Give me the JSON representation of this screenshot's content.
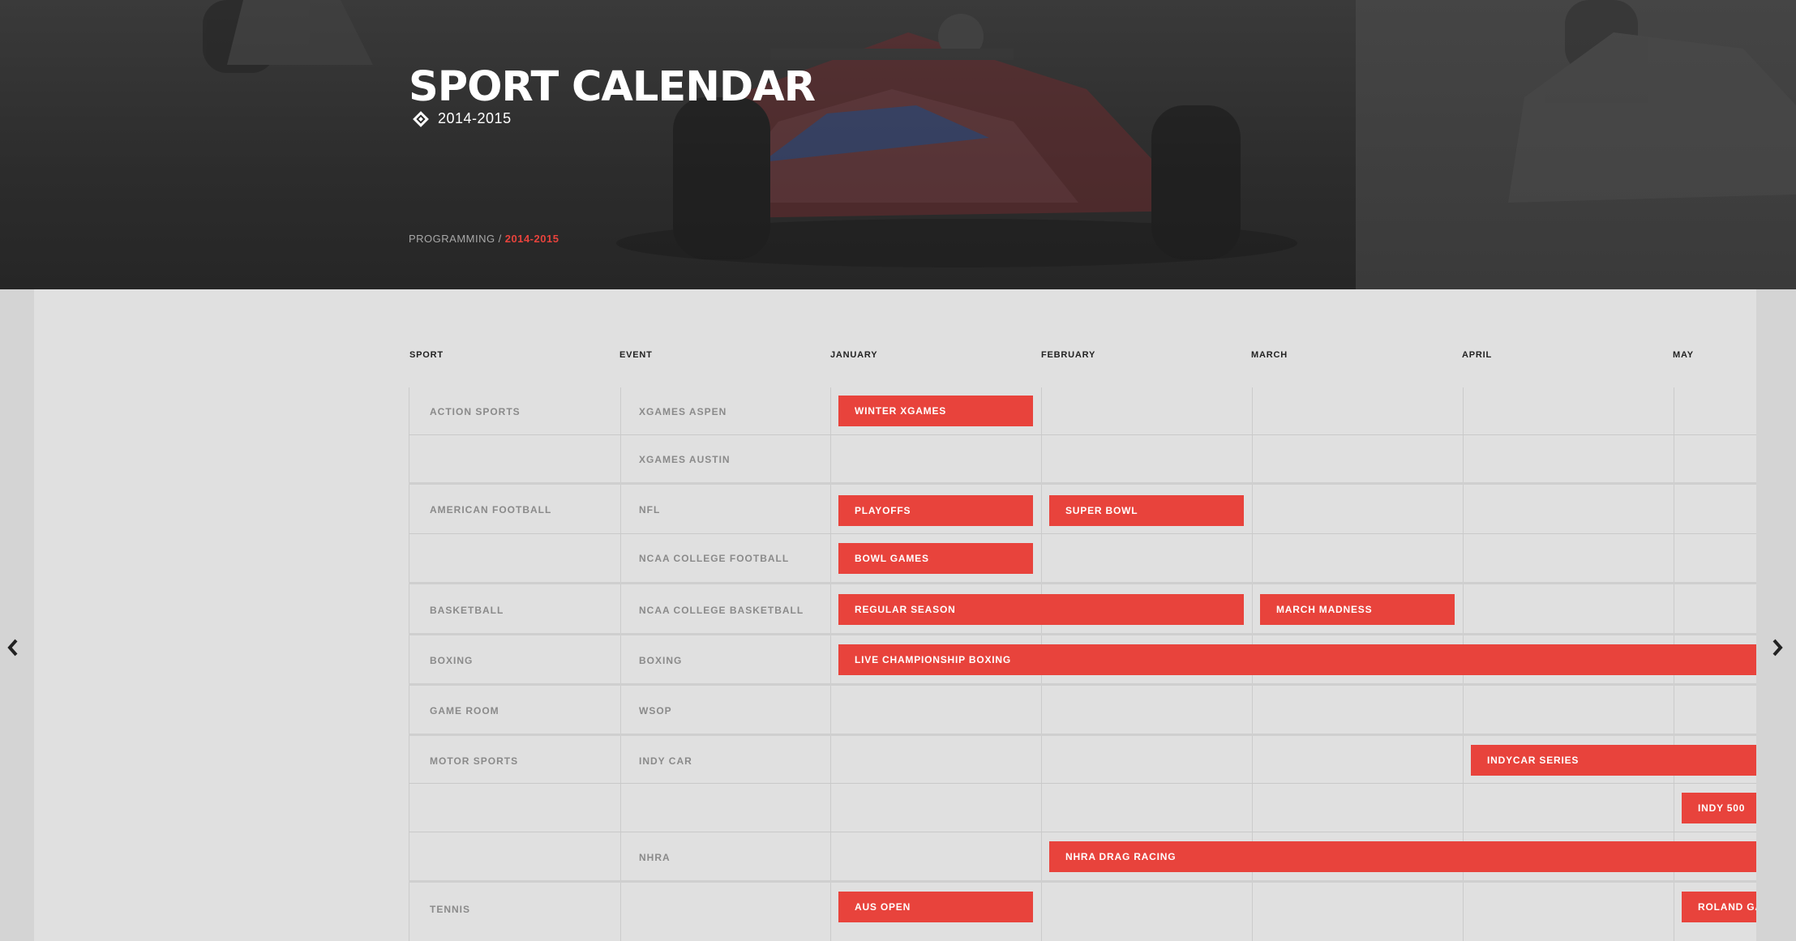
{
  "header": {
    "title": "SPORT CALENDAR",
    "season": "2014-2015",
    "breadcrumb": {
      "parent": "PROGRAMMING",
      "separator": "/",
      "current": "2014-2015"
    }
  },
  "columns": {
    "sport": "SPORT",
    "event": "EVENT",
    "months": [
      "JANUARY",
      "FEBRUARY",
      "MARCH",
      "APRIL",
      "MAY"
    ]
  },
  "rows": [
    {
      "sport": "ACTION SPORTS",
      "event": "XGAMES ASPEN"
    },
    {
      "sport": "",
      "event": "XGAMES AUSTIN"
    },
    {
      "sport": "AMERICAN FOOTBALL",
      "event": "NFL"
    },
    {
      "sport": "",
      "event": "NCAA COLLEGE FOOTBALL"
    },
    {
      "sport": "BASKETBALL",
      "event": "NCAA COLLEGE BASKETBALL"
    },
    {
      "sport": "BOXING",
      "event": "BOXING"
    },
    {
      "sport": "GAME ROOM",
      "event": "WSOP"
    },
    {
      "sport": "MOTOR SPORTS",
      "event": "INDY CAR"
    },
    {
      "sport": "",
      "event": ""
    },
    {
      "sport": "",
      "event": "NHRA"
    },
    {
      "sport": "TENNIS",
      "event": ""
    }
  ],
  "events": [
    {
      "label": "WINTER XGAMES"
    },
    {
      "label": "PLAYOFFS"
    },
    {
      "label": "SUPER BOWL"
    },
    {
      "label": "BOWL GAMES"
    },
    {
      "label": "REGULAR SEASON"
    },
    {
      "label": "MARCH MADNESS"
    },
    {
      "label": "LIVE CHAMPIONSHIP BOXING"
    },
    {
      "label": "INDYCAR SERIES"
    },
    {
      "label": "INDY 500"
    },
    {
      "label": "NHRA DRAG RACING"
    },
    {
      "label": "AUS OPEN"
    },
    {
      "label": "ROLAND GA"
    }
  ],
  "colors": {
    "accent": "#e8433c",
    "panel": "#e0e0e0",
    "hero": "#2c2c2c"
  },
  "icons": {
    "prev": "chevron-left-icon",
    "next": "chevron-right-icon",
    "season": "diamond-icon"
  }
}
